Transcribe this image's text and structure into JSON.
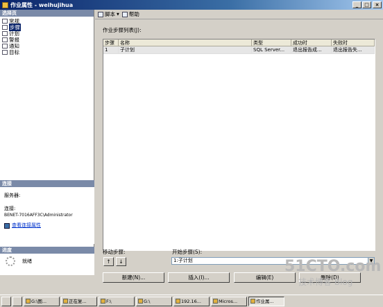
{
  "window": {
    "title": "作业属性 - weihujihua",
    "min": "_",
    "max": "□",
    "close": "×"
  },
  "left": {
    "select_page_header": "选择页",
    "pages": [
      "常规",
      "步骤",
      "计划",
      "警报",
      "通知",
      "目标"
    ],
    "connection_header": "连接",
    "server_label": "服务器:",
    "connection_label": "连接:",
    "connection_value": "BENET-7016AFF3C\\Administrator",
    "view_conn_link": "查看连接属性",
    "progress_header": "进度",
    "progress_status": "就绪"
  },
  "toolbar": {
    "script": "脚本",
    "help": "帮助"
  },
  "main": {
    "steps_list_label": "作业步骤列表(J):",
    "columns": [
      "步骤",
      "名称",
      "类型",
      "成功时",
      "失败时"
    ],
    "rows": [
      [
        "1",
        "子计划",
        "SQL Server...",
        "退出报告成...",
        "退出报告失..."
      ]
    ],
    "move_step_label": "移动步骤:",
    "start_step_label": "开始步骤(S):",
    "start_step_value": "1:子计划",
    "buttons": {
      "new": "新建(N)...",
      "insert": "插入(I)...",
      "edit": "编辑(E)",
      "delete": "删除(D)"
    },
    "up": "↑",
    "down": "↓"
  },
  "taskbar": [
    "G:\\图...",
    "正在复...",
    "F:\\",
    "G:\\",
    "192.16...",
    "Micros...",
    "作业属..."
  ],
  "watermark": {
    "line1": "51CTO.com",
    "line2": "技术博客 Blog"
  }
}
